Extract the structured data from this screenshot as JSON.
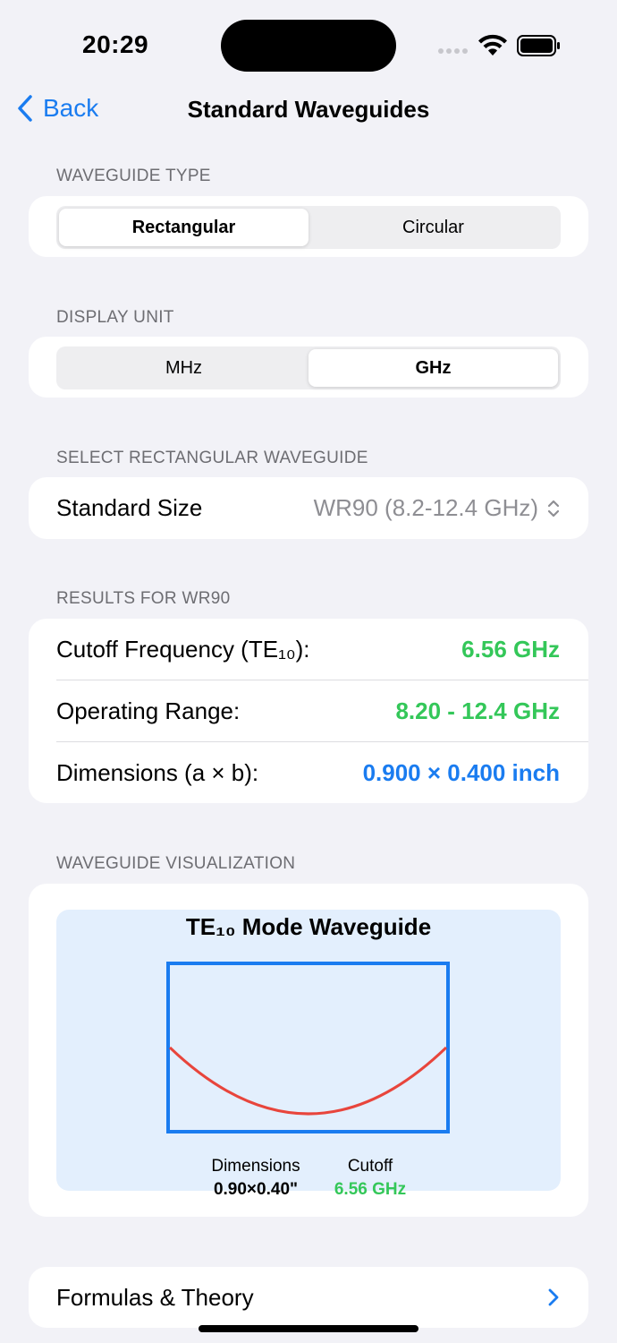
{
  "status_bar": {
    "time": "20:29"
  },
  "nav": {
    "back_label": "Back",
    "title": "Standard Waveguides"
  },
  "waveguide_type": {
    "header": "WAVEGUIDE TYPE",
    "options": [
      "Rectangular",
      "Circular"
    ],
    "selected": "Rectangular"
  },
  "display_unit": {
    "header": "DISPLAY UNIT",
    "options": [
      "MHz",
      "GHz"
    ],
    "selected": "GHz"
  },
  "select_waveguide": {
    "header": "SELECT RECTANGULAR WAVEGUIDE",
    "label": "Standard Size",
    "value": "WR90 (8.2-12.4 GHz)"
  },
  "results": {
    "header": "RESULTS FOR WR90",
    "rows": [
      {
        "label": "Cutoff Frequency (TE₁₀):",
        "value": "6.56 GHz",
        "color": "#34c759"
      },
      {
        "label": "Operating Range:",
        "value": "8.20 - 12.4 GHz",
        "color": "#34c759"
      },
      {
        "label": "Dimensions (a × b):",
        "value": "0.900 × 0.400 inch",
        "color": "#1a7cf0"
      }
    ]
  },
  "visualization": {
    "header": "WAVEGUIDE VISUALIZATION",
    "title": "TE₁₀ Mode Waveguide",
    "dimensions_label": "Dimensions",
    "dimensions_value": "0.90×0.40\"",
    "cutoff_label": "Cutoff",
    "cutoff_value": "6.56 GHz",
    "outline_color": "#1a7cf0",
    "mode_curve_color": "#e8453c"
  },
  "formulas": {
    "label": "Formulas & Theory"
  },
  "colors": {
    "accent": "#1a7cf0",
    "positive": "#34c759",
    "background": "#f2f2f7"
  }
}
